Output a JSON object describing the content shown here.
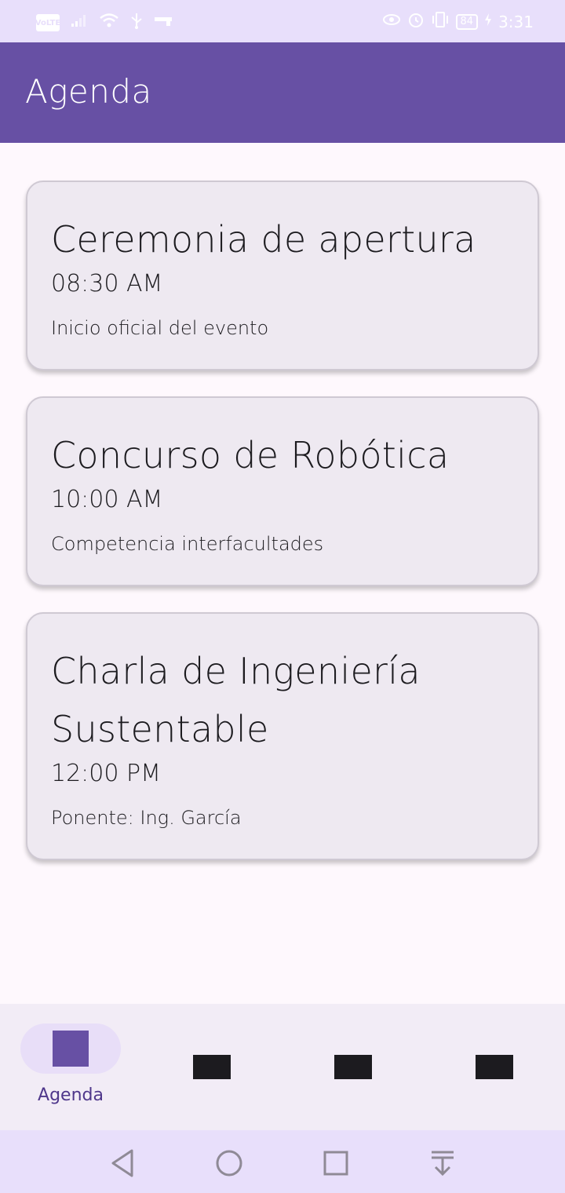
{
  "status_bar": {
    "volte": "VoLTE",
    "battery": "84",
    "time": "3:31"
  },
  "app_bar": {
    "title": "Agenda"
  },
  "events": [
    {
      "title": "Ceremonia de apertura",
      "time": "08:30 AM",
      "description": "Inicio oficial del evento"
    },
    {
      "title": "Concurso de Robótica",
      "time": "10:00 AM",
      "description": "Competencia interfacultades"
    },
    {
      "title_line1": "Charla de Ingeniería",
      "title_line2": "Sustentable",
      "time": "12:00 PM",
      "description": "Ponente: Ing. García"
    }
  ],
  "bottom_nav": {
    "items": [
      {
        "label": "Agenda",
        "selected": true,
        "icon": "agenda-icon"
      },
      {
        "label": "",
        "selected": false,
        "icon": "placeholder-icon"
      },
      {
        "label": "",
        "selected": false,
        "icon": "placeholder-icon"
      },
      {
        "label": "",
        "selected": false,
        "icon": "placeholder-icon"
      }
    ]
  },
  "colors": {
    "primary": "#6750a4",
    "status_bar": "#e8dffb",
    "card": "#eee9f1",
    "nav_indicator": "#e8def8"
  },
  "system_nav": [
    "back-icon",
    "home-icon",
    "recents-icon",
    "notification-pull-icon"
  ]
}
